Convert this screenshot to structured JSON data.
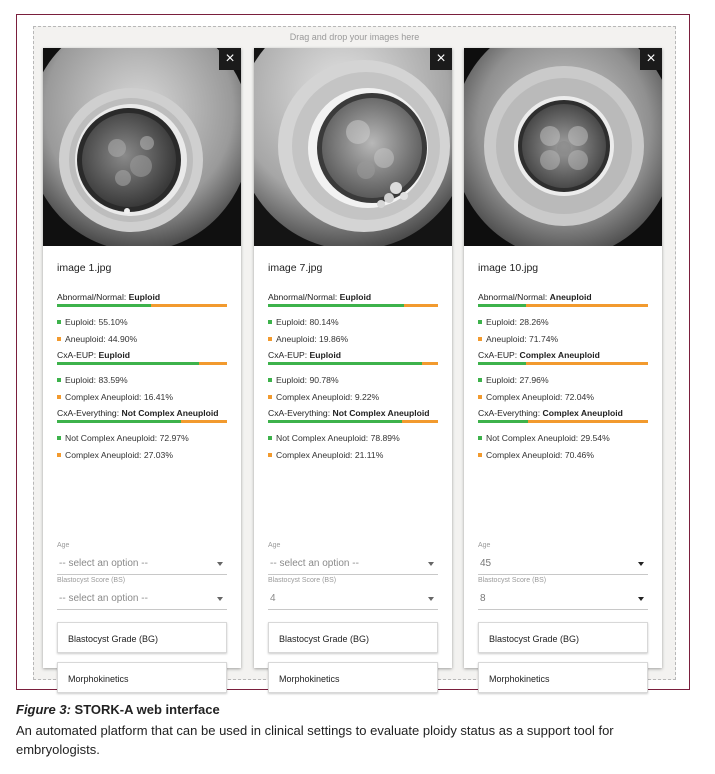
{
  "figure": {
    "label": "Figure 3:",
    "title": "STORK-A web interface",
    "caption": "An automated platform that can be used in clinical settings to evaluate ploidy status as a support tool for embryologists."
  },
  "dropzone": {
    "label": "Drag and drop your images here"
  },
  "colors": {
    "positive": "#3db24b",
    "negative": "#f29a2e",
    "frame": "#7a1f3d"
  },
  "cards": [
    {
      "close_icon": "×",
      "filename": "image 1.jpg",
      "sections": [
        {
          "title": "Abnormal/Normal: ",
          "result": "Euploid",
          "fraction": 0.551,
          "items": [
            {
              "text": "Euploid: 55.10%"
            },
            {
              "text": "Aneuploid: 44.90%"
            }
          ]
        },
        {
          "title": "CxA-EUP: ",
          "result": "Euploid",
          "fraction": 0.8359,
          "items": [
            {
              "text": "Euploid: 83.59%"
            },
            {
              "text": "Complex Aneuploid: 16.41%"
            }
          ]
        },
        {
          "title": "CxA-Everything: ",
          "result": "Not Complex Aneuploid",
          "fraction": 0.7297,
          "items": [
            {
              "text": "Not Complex Aneuploid: 72.97%"
            },
            {
              "text": "Complex Aneuploid: 27.03%"
            }
          ]
        }
      ],
      "age_label": "Age",
      "age_value": "-- select an option --",
      "bs_label": "Blastocyst Score (BS)",
      "bs_value": "-- select an option --",
      "bg_button": "Blastocyst Grade (BG)",
      "morpho_button": "Morphokinetics"
    },
    {
      "close_icon": "×",
      "filename": "image 7.jpg",
      "sections": [
        {
          "title": "Abnormal/Normal: ",
          "result": "Euploid",
          "fraction": 0.8014,
          "items": [
            {
              "text": "Euploid: 80.14%"
            },
            {
              "text": "Aneuploid: 19.86%"
            }
          ]
        },
        {
          "title": "CxA-EUP: ",
          "result": "Euploid",
          "fraction": 0.9078,
          "items": [
            {
              "text": "Euploid: 90.78%"
            },
            {
              "text": "Complex Aneuploid: 9.22%"
            }
          ]
        },
        {
          "title": "CxA-Everything: ",
          "result": "Not Complex Aneuploid",
          "fraction": 0.7889,
          "items": [
            {
              "text": "Not Complex Aneuploid: 78.89%"
            },
            {
              "text": "Complex Aneuploid: 21.11%"
            }
          ]
        }
      ],
      "age_label": "Age",
      "age_value": "-- select an option --",
      "bs_label": "Blastocyst Score (BS)",
      "bs_value": "4",
      "bg_button": "Blastocyst Grade (BG)",
      "morpho_button": "Morphokinetics"
    },
    {
      "close_icon": "×",
      "filename": "image 10.jpg",
      "sections": [
        {
          "title": "Abnormal/Normal: ",
          "result": "Aneuploid",
          "fraction": 0.2826,
          "items": [
            {
              "text": "Euploid: 28.26%"
            },
            {
              "text": "Aneuploid: 71.74%"
            }
          ]
        },
        {
          "title": "CxA-EUP: ",
          "result": "Complex Aneuploid",
          "fraction": 0.2796,
          "items": [
            {
              "text": "Euploid: 27.96%"
            },
            {
              "text": "Complex Aneuploid: 72.04%"
            }
          ]
        },
        {
          "title": "CxA-Everything: ",
          "result": "Complex Aneuploid",
          "fraction": 0.2954,
          "items": [
            {
              "text": "Not Complex Aneuploid: 29.54%"
            },
            {
              "text": "Complex Aneuploid: 70.46%"
            }
          ]
        }
      ],
      "age_label": "Age",
      "age_value": "45",
      "bs_label": "Blastocyst Score (BS)",
      "bs_value": "8",
      "bg_button": "Blastocyst Grade (BG)",
      "morpho_button": "Morphokinetics"
    }
  ]
}
